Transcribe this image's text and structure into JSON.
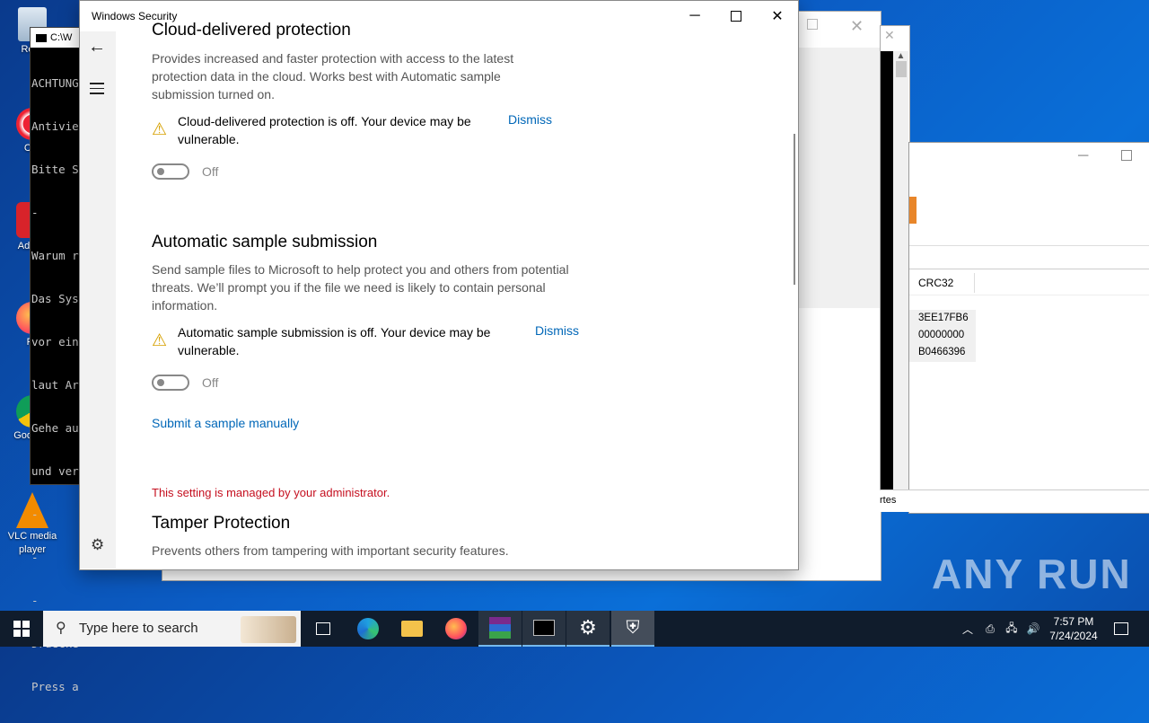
{
  "desktop": {
    "icons": [
      {
        "label": "Recy"
      },
      {
        "label": "CCl"
      },
      {
        "label": "Ad Acr"
      },
      {
        "label": "Fir"
      },
      {
        "label": "Goo Chr"
      },
      {
        "label": "VLC media player"
      }
    ],
    "watermark": "ANY RUN"
  },
  "cmd_window": {
    "title": "C:\\W",
    "lines": [
      "ACHTUNG",
      "Antivie",
      "Bitte S",
      "-",
      "Warum r",
      "Das Sys",
      "vor ein",
      "laut Ar",
      "Gehe au",
      "und ver",
      "-",
      "-",
      "-",
      "Druecke",
      "Press a"
    ]
  },
  "bg_window": {
    "column_header": "CRC32",
    "crc_values": [
      "3EE17FB6",
      "00000000",
      "B0466396"
    ],
    "status_fragment": "rtes"
  },
  "security_window": {
    "title": "Windows Security",
    "sections": [
      {
        "heading": "Cloud-delivered protection",
        "description": "Provides increased and faster protection with access to the latest protection data in the cloud. Works best with Automatic sample submission turned on.",
        "warning": "Cloud-delivered protection is off. Your device may be vulnerable.",
        "dismiss": "Dismiss",
        "toggle_state": "Off",
        "toggle_on": false
      },
      {
        "heading": "Automatic sample submission",
        "description": "Send sample files to Microsoft to help protect you and others from potential threats. We’ll prompt you if the file we need is likely to contain personal information.",
        "warning": "Automatic sample submission is off. Your device may be vulnerable.",
        "dismiss": "Dismiss",
        "toggle_state": "Off",
        "toggle_on": false
      }
    ],
    "submit_link": "Submit a sample manually",
    "admin_notice": "This setting is managed by your administrator.",
    "tamper": {
      "heading": "Tamper Protection",
      "description": "Prevents others from tampering with important security features."
    }
  },
  "taskbar": {
    "search_placeholder": "Type here to search",
    "time": "7:57 PM",
    "date": "7/24/2024"
  }
}
